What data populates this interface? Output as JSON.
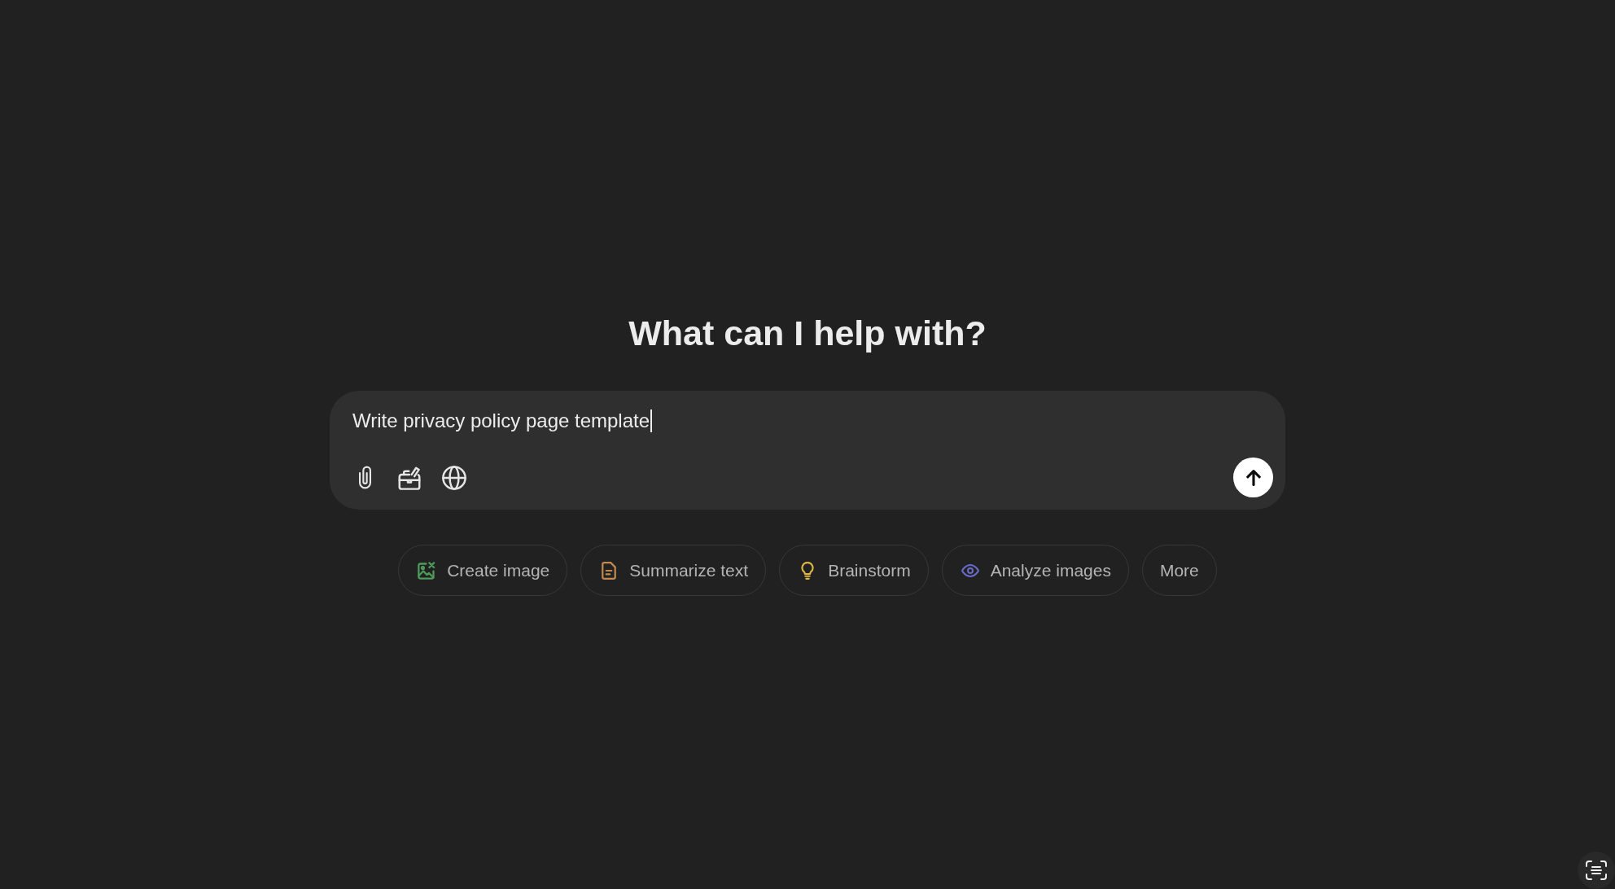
{
  "heading": "What can I help with?",
  "composer": {
    "value": "Write privacy policy page template",
    "focused": true,
    "send_enabled": true
  },
  "suggestions": [
    {
      "label": "Create image",
      "kind": "image",
      "color": "#4e9a5b"
    },
    {
      "label": "Summarize text",
      "kind": "document",
      "color": "#c4894f"
    },
    {
      "label": "Brainstorm",
      "kind": "bulb",
      "color": "#dbb845"
    },
    {
      "label": "Analyze images",
      "kind": "eye",
      "color": "#6b69c8"
    },
    {
      "label": "More",
      "kind": "more"
    }
  ]
}
